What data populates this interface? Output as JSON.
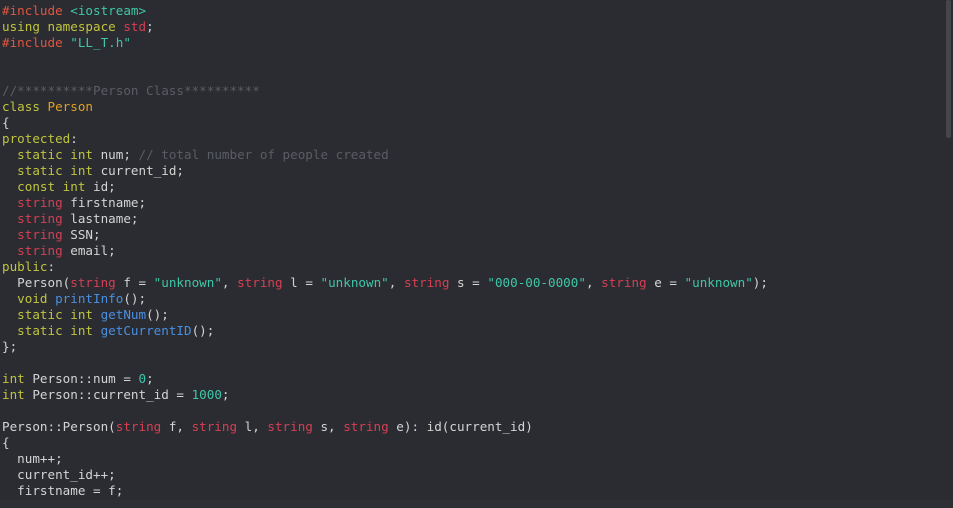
{
  "editor": {
    "language": "cpp",
    "lines": [
      [
        {
          "t": "#include ",
          "c": "pp"
        },
        {
          "t": "<iostream>",
          "c": "inc"
        }
      ],
      [
        {
          "t": "using namespace ",
          "c": "kw"
        },
        {
          "t": "std",
          "c": "ty"
        },
        {
          "t": ";",
          "c": "op"
        }
      ],
      [
        {
          "t": "#include ",
          "c": "pp"
        },
        {
          "t": "\"LL_T.h\"",
          "c": "inc"
        }
      ],
      [],
      [],
      [
        {
          "t": "//**********Person Class**********",
          "c": "cm"
        }
      ],
      [
        {
          "t": "class ",
          "c": "kw"
        },
        {
          "t": "Person",
          "c": "cls"
        }
      ],
      [
        {
          "t": "{",
          "c": "op"
        }
      ],
      [
        {
          "t": "protected",
          "c": "kw"
        },
        {
          "t": ":",
          "c": "op"
        }
      ],
      [
        {
          "t": "  static int ",
          "c": "kw"
        },
        {
          "t": "num; ",
          "c": "id"
        },
        {
          "t": "// total number of people created",
          "c": "cm"
        }
      ],
      [
        {
          "t": "  static int ",
          "c": "kw"
        },
        {
          "t": "current_id;",
          "c": "id"
        }
      ],
      [
        {
          "t": "  const int ",
          "c": "kw"
        },
        {
          "t": "id;",
          "c": "id"
        }
      ],
      [
        {
          "t": "  string ",
          "c": "ty"
        },
        {
          "t": "firstname;",
          "c": "id"
        }
      ],
      [
        {
          "t": "  string ",
          "c": "ty"
        },
        {
          "t": "lastname;",
          "c": "id"
        }
      ],
      [
        {
          "t": "  string ",
          "c": "ty"
        },
        {
          "t": "SSN;",
          "c": "id"
        }
      ],
      [
        {
          "t": "  string ",
          "c": "ty"
        },
        {
          "t": "email;",
          "c": "id"
        }
      ],
      [
        {
          "t": "public",
          "c": "kw"
        },
        {
          "t": ":",
          "c": "op"
        }
      ],
      [
        {
          "t": "  Person(",
          "c": "id"
        },
        {
          "t": "string ",
          "c": "ty"
        },
        {
          "t": "f = ",
          "c": "id"
        },
        {
          "t": "\"unknown\"",
          "c": "str"
        },
        {
          "t": ", ",
          "c": "id"
        },
        {
          "t": "string ",
          "c": "ty"
        },
        {
          "t": "l = ",
          "c": "id"
        },
        {
          "t": "\"unknown\"",
          "c": "str"
        },
        {
          "t": ", ",
          "c": "id"
        },
        {
          "t": "string ",
          "c": "ty"
        },
        {
          "t": "s = ",
          "c": "id"
        },
        {
          "t": "\"000-00-0000\"",
          "c": "str"
        },
        {
          "t": ", ",
          "c": "id"
        },
        {
          "t": "string ",
          "c": "ty"
        },
        {
          "t": "e = ",
          "c": "id"
        },
        {
          "t": "\"unknown\"",
          "c": "str"
        },
        {
          "t": ");",
          "c": "id"
        }
      ],
      [
        {
          "t": "  void ",
          "c": "kw"
        },
        {
          "t": "printInfo",
          "c": "fn"
        },
        {
          "t": "();",
          "c": "id"
        }
      ],
      [
        {
          "t": "  static int ",
          "c": "kw"
        },
        {
          "t": "getNum",
          "c": "fn"
        },
        {
          "t": "();",
          "c": "id"
        }
      ],
      [
        {
          "t": "  static int ",
          "c": "kw"
        },
        {
          "t": "getCurrentID",
          "c": "fn"
        },
        {
          "t": "();",
          "c": "id"
        }
      ],
      [
        {
          "t": "};",
          "c": "op"
        }
      ],
      [],
      [
        {
          "t": "int ",
          "c": "kw"
        },
        {
          "t": "Person::num = ",
          "c": "id"
        },
        {
          "t": "0",
          "c": "num"
        },
        {
          "t": ";",
          "c": "id"
        }
      ],
      [
        {
          "t": "int ",
          "c": "kw"
        },
        {
          "t": "Person::current_id = ",
          "c": "id"
        },
        {
          "t": "1000",
          "c": "num"
        },
        {
          "t": ";",
          "c": "id"
        }
      ],
      [],
      [
        {
          "t": "Person::Person(",
          "c": "id"
        },
        {
          "t": "string ",
          "c": "ty"
        },
        {
          "t": "f, ",
          "c": "id"
        },
        {
          "t": "string ",
          "c": "ty"
        },
        {
          "t": "l, ",
          "c": "id"
        },
        {
          "t": "string ",
          "c": "ty"
        },
        {
          "t": "s, ",
          "c": "id"
        },
        {
          "t": "string ",
          "c": "ty"
        },
        {
          "t": "e): id(current_id)",
          "c": "id"
        }
      ],
      [
        {
          "t": "{",
          "c": "op"
        }
      ],
      [
        {
          "t": "  num++;",
          "c": "id"
        }
      ],
      [
        {
          "t": "  current_id++;",
          "c": "id"
        }
      ],
      [
        {
          "t": "  firstname = f;",
          "c": "id"
        }
      ]
    ]
  }
}
